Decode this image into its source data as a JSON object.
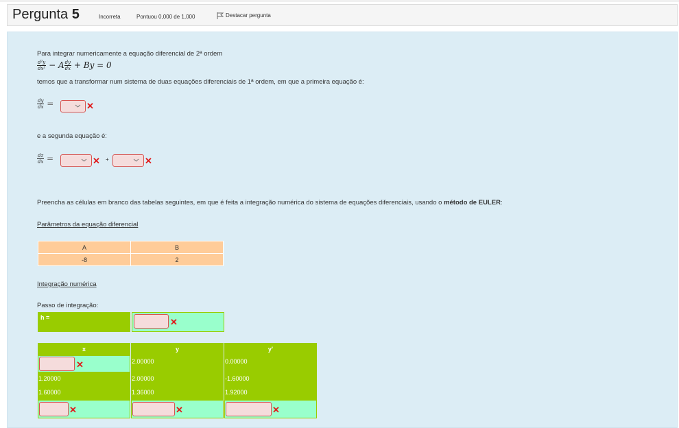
{
  "header": {
    "title_prefix": "Pergunta",
    "number": "5",
    "status": "Incorreta",
    "score": "Pontuou 0,000 de 1,000",
    "flag_label": "Destacar pergunta"
  },
  "body": {
    "intro": "Para integrar numericamente a equação diferencial de 2ª ordem",
    "eq_mid1": "− A",
    "eq_mid2": "+ By = 0",
    "transform_text": "temos que a transformar num sistema de duas equações diferenciais de 1ª ordem, em que a primeira equação é:",
    "second_text": "e a segunda equação é:",
    "plus": "+",
    "equals": "=",
    "fill_text_pre": "Preencha as células em branco das tabelas seguintes, em que é feita a integração numérica do sistema de equações diferenciais, usando o ",
    "fill_text_bold": "método de EULER",
    "fill_text_post": ":",
    "params_heading": "Parâmetros da equação diferencial",
    "integration_heading": "Integração numérica",
    "step_label": "Passo de integração:"
  },
  "params": {
    "headers": [
      "A",
      "B"
    ],
    "values": [
      "-8",
      "2"
    ]
  },
  "step": {
    "label": "h ="
  },
  "grid": {
    "headers": [
      "x",
      "y",
      "y'"
    ],
    "row1": {
      "y": "2.00000",
      "yp": "0.00000"
    },
    "row2": {
      "x": "1.20000",
      "y": "2.00000",
      "yp": "-1.60000"
    },
    "row3": {
      "x": "1.60000",
      "y": "1.36000",
      "yp": "1.92000"
    }
  },
  "icons": {
    "wrong": "✕",
    "chevron": "﹀"
  },
  "colors": {
    "incorrect_border": "#d9534f",
    "incorrect_mark": "#e01b1b",
    "header_green": "#99cc00",
    "input_mint": "#99ffcc",
    "params_orange": "#ffcc99",
    "body_blue": "#dcedf5"
  }
}
